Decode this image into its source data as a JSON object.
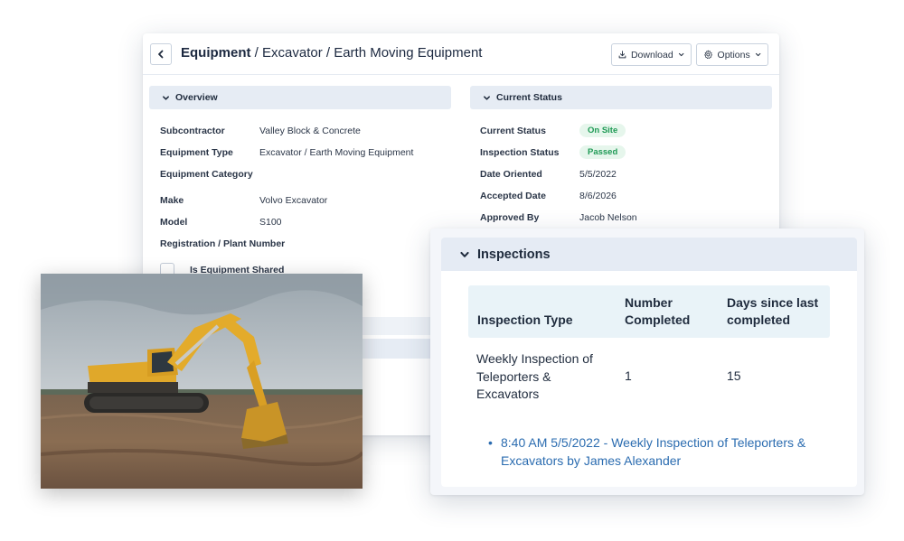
{
  "header": {
    "title_bold": "Equipment",
    "title_rest": " / Excavator / Earth Moving Equipment",
    "download_label": "Download",
    "options_label": "Options"
  },
  "overview": {
    "title": "Overview",
    "fields": [
      {
        "label": "Subcontractor",
        "value": "Valley Block & Concrete"
      },
      {
        "label": "Equipment Type",
        "value": "Excavator / Earth Moving Equipment"
      },
      {
        "label": "Equipment Category",
        "value": ""
      },
      {
        "label": "Make",
        "value": "Volvo Excavator"
      },
      {
        "label": "Model",
        "value": "S100"
      },
      {
        "label": "Registration / Plant Number",
        "value": ""
      }
    ],
    "shared_label": "Is Equipment Shared",
    "shared_checked": false
  },
  "current_status": {
    "title": "Current Status",
    "fields": [
      {
        "label": "Current Status",
        "value": "On Site"
      },
      {
        "label": "Inspection Status",
        "value": "Passed"
      },
      {
        "label": "Date Oriented",
        "value": "5/5/2022"
      },
      {
        "label": "Accepted Date",
        "value": "8/6/2026"
      },
      {
        "label": "Approved By",
        "value": "Jacob Nelson"
      }
    ]
  },
  "inspections": {
    "title": "Inspections",
    "columns": [
      "Inspection Type",
      "Number Completed",
      "Days since last completed"
    ],
    "rows": [
      {
        "type": "Weekly Inspection of Teleporters & Excavators",
        "number": "1",
        "days": "15"
      }
    ],
    "links": [
      "8:40 AM 5/5/2022 - Weekly Inspection of Teleporters & Excavators by James Alexander"
    ]
  },
  "colors": {
    "accent_link": "#2b6cb0",
    "status_green": "#1f9a55",
    "section_header": "#e6ecf4"
  },
  "icons": [
    "chevron-left-icon",
    "download-icon",
    "gear-icon",
    "chevron-down-icon"
  ]
}
